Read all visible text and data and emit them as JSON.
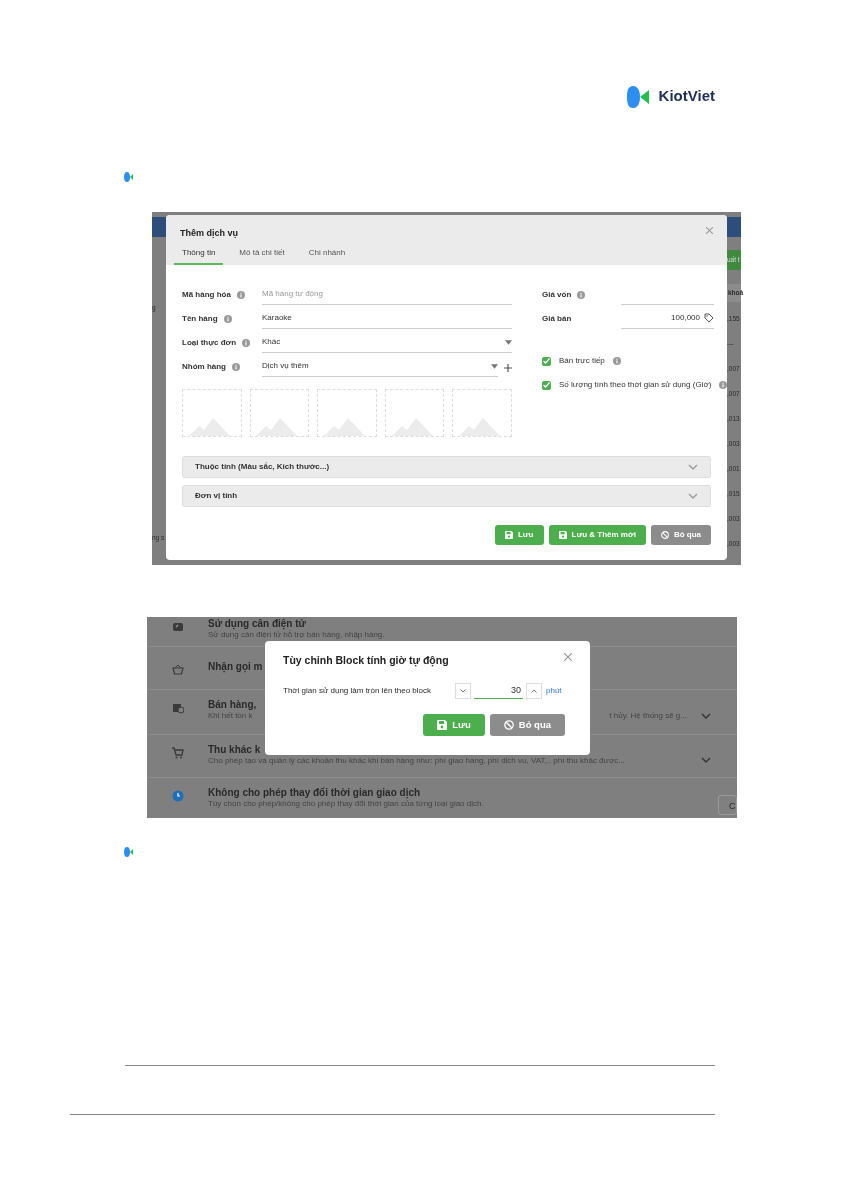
{
  "logo": {
    "text": "KiotViet"
  },
  "screenshot_1": {
    "left_edge": [
      "g",
      "ng s"
    ],
    "right_edge": [
      {
        "text": "uất t",
        "kind": "button"
      },
      {
        "text": "khoả",
        "kind": "header"
      },
      {
        "text": ",155",
        "kind": "cell"
      },
      {
        "text": "---",
        "kind": "cell"
      },
      {
        "text": ",007",
        "kind": "cell"
      },
      {
        "text": ",007",
        "kind": "cell"
      },
      {
        "text": ",013",
        "kind": "cell"
      },
      {
        "text": ",003",
        "kind": "cell"
      },
      {
        "text": ",001",
        "kind": "cell"
      },
      {
        "text": ",015",
        "kind": "cell"
      },
      {
        "text": ",003",
        "kind": "cell"
      },
      {
        "text": ",003",
        "kind": "cell"
      }
    ],
    "dialog": {
      "title": "Thêm dịch vụ",
      "tabs": [
        {
          "label": "Thông tin",
          "selected": true
        },
        {
          "label": "Mô tả chi tiết",
          "selected": false
        },
        {
          "label": "Chi nhánh",
          "selected": false
        }
      ],
      "fields_left": [
        {
          "label": "Mã hàng hóa",
          "placeholder": "Mã hàng tự động",
          "kind": "text"
        },
        {
          "label": "Tên hàng",
          "value": "Karaoke",
          "kind": "text"
        },
        {
          "label": "Loại thực đơn",
          "value": "Khác",
          "kind": "select"
        },
        {
          "label": "Nhóm hàng",
          "value": "Dịch vụ thêm",
          "kind": "select-add"
        }
      ],
      "fields_right": [
        {
          "label": "Giá vốn",
          "kind": "text"
        },
        {
          "label": "Giá bán",
          "value": "100,000",
          "kind": "price"
        }
      ],
      "checkboxes": [
        {
          "label": "Bán trực tiếp",
          "checked": true
        },
        {
          "label": "Số lượng tính theo thời gian sử dụng (Giờ)",
          "checked": true
        }
      ],
      "images": [
        {
          "kind": "placeholder"
        },
        {
          "kind": "placeholder"
        },
        {
          "kind": "placeholder"
        },
        {
          "kind": "placeholder"
        },
        {
          "kind": "placeholder"
        }
      ],
      "sections": [
        {
          "title": "Thuộc tính (Màu sắc, Kích thước...)",
          "expanded": false
        },
        {
          "title": "Đơn vị tính",
          "expanded": false
        }
      ],
      "buttons": [
        {
          "label": "Lưu",
          "kind": "save"
        },
        {
          "label": "Lưu & Thêm mới",
          "kind": "save"
        },
        {
          "label": "Bỏ qua",
          "kind": "cancel"
        }
      ]
    }
  },
  "screenshot_2": {
    "settings": [
      {
        "kind": "scale",
        "title": "Sử dụng cân điện tử",
        "description": "Sử dụng cân điện tử hỗ trợ bán hàng, nhập hàng.",
        "expandable": false
      },
      {
        "kind": "basket",
        "title": "Nhận gọi m",
        "expandable": false
      },
      {
        "kind": "store",
        "title": "Bán hàng,",
        "description": "Khi hết tồn k",
        "description_right": "t hủy. Hệ thống sẽ g...",
        "expandable": true
      },
      {
        "kind": "cart",
        "title": "Thu khác k",
        "description": "Cho phép tạo và quản lý các khoản thu khác khi bán hàng như: phí giao hàng, phí dịch vụ, VAT,.. phí thu khác được...",
        "expandable": true
      },
      {
        "kind": "clock",
        "title": "Không cho phép thay đổi thời gian giao dịch",
        "description": "Tùy chọn cho phép/không cho phép thay đổi thời gian của từng loại giao dịch.",
        "button": "C",
        "expandable": false
      }
    ],
    "dialog": {
      "title": "Tùy chỉnh Block tính giờ tự động",
      "field_label": "Thời gian sử dụng làm tròn lên theo block",
      "value": "30",
      "unit": "phút",
      "buttons": [
        {
          "label": "Lưu",
          "kind": "save"
        },
        {
          "label": "Bỏ qua",
          "kind": "cancel"
        }
      ]
    }
  }
}
